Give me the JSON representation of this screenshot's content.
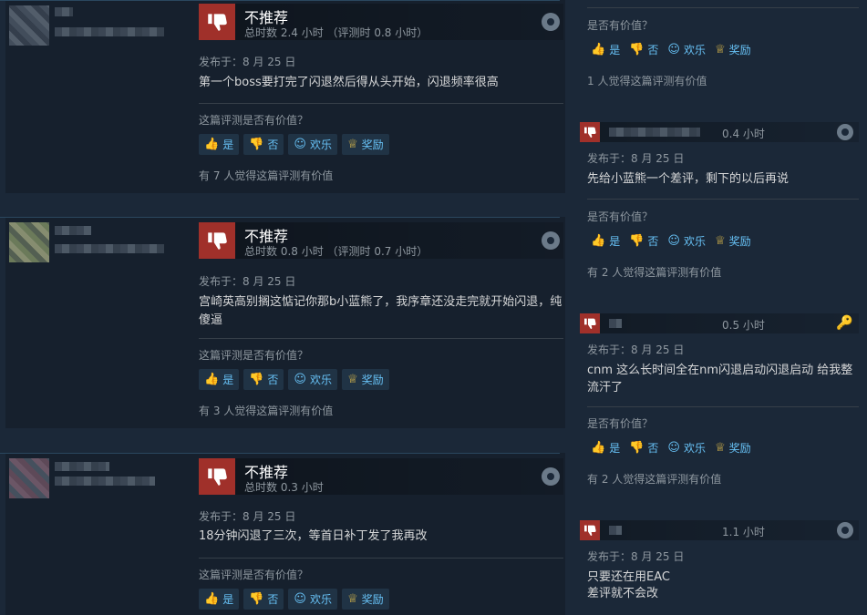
{
  "left_reviews": [
    {
      "verdict": "不推荐",
      "hours": "总时数 2.4 小时 （评测时 0.8 小时）",
      "posted": "发布于：8 月 25 日",
      "text": "第一个boss要打完了闪退然后得从头开始，闪退频率很高",
      "helpful_q": "这篇评测是否有价值？",
      "found": "有 7 人觉得这篇评测有价值"
    },
    {
      "verdict": "不推荐",
      "hours": "总时数 0.8 小时 （评测时 0.7 小时）",
      "posted": "发布于：8 月 25 日",
      "text": "宫崎英高别搁这惦记你那b小蓝熊了，我序章还没走完就开始闪退，纯傻逼",
      "helpful_q": "这篇评测是否有价值？",
      "found": "有 3 人觉得这篇评测有价值"
    },
    {
      "verdict": "不推荐",
      "hours": "总时数 0.3 小时",
      "posted": "发布于：8 月 25 日",
      "text": "18分钟闪退了三次，等首日补丁发了我再改",
      "helpful_q": "这篇评测是否有价值？"
    }
  ],
  "buttons": {
    "yes": "是",
    "no": "否",
    "funny": "欢乐",
    "award": "奖励"
  },
  "right_reviews": [
    {
      "helpful_q": "是否有价值？",
      "found": "1 人觉得这篇评测有价值"
    },
    {
      "hours": "0.4 小时",
      "posted": "发布于：8 月 25 日",
      "text": "先给小蓝熊一个差评，剩下的以后再说",
      "helpful_q": "是否有价值？",
      "found": "有 2 人觉得这篇评测有价值"
    },
    {
      "hours": "0.5 小时",
      "posted": "发布于：8 月 25 日",
      "text": "cnm 这么长时间全在nm闪退启动闪退启动 给我整流汗了",
      "helpful_q": "是否有价值？",
      "found": "有 2 人觉得这篇评测有价值"
    },
    {
      "hours": "1.1 小时",
      "posted": "发布于：8 月 25 日",
      "text_line1": "只要还在用EAC",
      "text_line2": "差评就不会改"
    }
  ],
  "icons": {
    "thumb_down": "thumbs-down-icon",
    "thumb_up": "thumbs-up-icon",
    "funny": "smile-icon",
    "award": "award-icon",
    "platform": "steam-icon",
    "key": "key-icon"
  },
  "colors": {
    "background": "#1b2838",
    "not_recommended": "#a0302a",
    "link_blue": "#67c1f5"
  }
}
